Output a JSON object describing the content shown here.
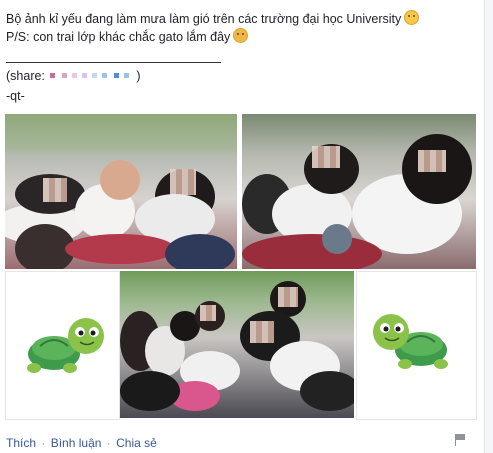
{
  "post": {
    "line1": "Bộ ảnh kỉ yếu đang làm mưa làm gió trên các trường đại học University",
    "line2": "P/S: con trai lớp khác chắc gato lắm đây",
    "share_open": "(share:",
    "share_close": ")",
    "signature": "-qt-",
    "emoji1": "smile-emoji",
    "emoji2": "tongue-emoji"
  },
  "actions": {
    "like": "Thích",
    "comment": "Bình luận",
    "share": "Chia sẻ",
    "separator": "·"
  },
  "colors": {
    "link": "#365899",
    "text": "#1d2129",
    "turtle_green": "#8bc34a",
    "turtle_shell": "#3f9b4c"
  }
}
